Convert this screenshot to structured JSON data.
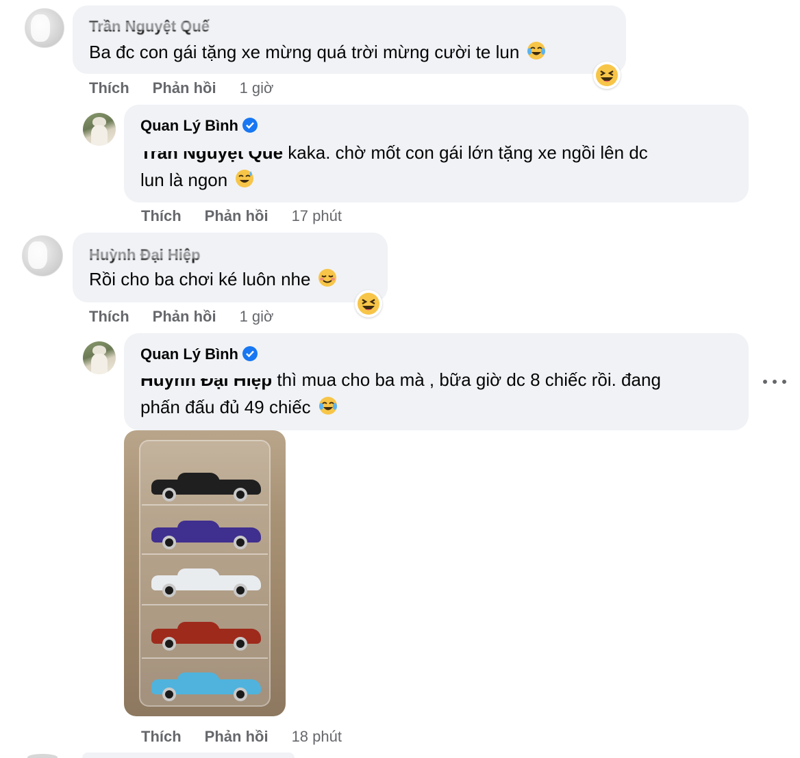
{
  "colors": {
    "bubble": "#f0f2f5",
    "text": "#050505",
    "secondary": "#65676b",
    "verified": "#1877f2"
  },
  "comments": [
    {
      "author": "Trần Nguyệt Quế",
      "text": "Ba đc con gái tặng xe mừng quá trời mừng cười te lun",
      "emoji": "tears-of-joy-emoji",
      "reaction": "laughing-reaction-icon",
      "actions": {
        "like": "Thích",
        "reply": "Phản hồi",
        "time": "1 giờ"
      }
    },
    {
      "author": "Quan Lý Bình",
      "verified": true,
      "mention": "Trần Nguyệt Quế",
      "text_line1": " kaka. chờ mốt con gái lớn tặng xe ngồi lên dc",
      "text_line2": "lun là ngon",
      "emoji": "sweat-smile-emoji",
      "actions": {
        "like": "Thích",
        "reply": "Phản hồi",
        "time": "17 phút"
      }
    },
    {
      "author": "Huỳnh Đại Hiệp",
      "text": "Rồi cho ba chơi ké luôn nhe",
      "emoji": "smiling-blush-emoji",
      "reaction": "laughing-reaction-icon",
      "actions": {
        "like": "Thích",
        "reply": "Phản hồi",
        "time": "1 giờ"
      }
    },
    {
      "author": "Quan Lý Bình",
      "verified": true,
      "mention": "Huỳnh Đại Hiệp",
      "text_line1": " thì mua cho ba mà , bữa giờ dc 8 chiếc rồi. đang",
      "text_line2": "phấn đấu đủ 49 chiếc",
      "emoji": "tears-of-joy-emoji",
      "actions": {
        "like": "Thích",
        "reply": "Phản hồi",
        "time": "18 phút"
      }
    }
  ],
  "photo": {
    "cars": [
      {
        "color": "#1f1f1f"
      },
      {
        "color": "#3f2f8f"
      },
      {
        "color": "#e9ecef"
      },
      {
        "color": "#9e2a1c"
      },
      {
        "color": "#4fb3dd"
      }
    ]
  }
}
